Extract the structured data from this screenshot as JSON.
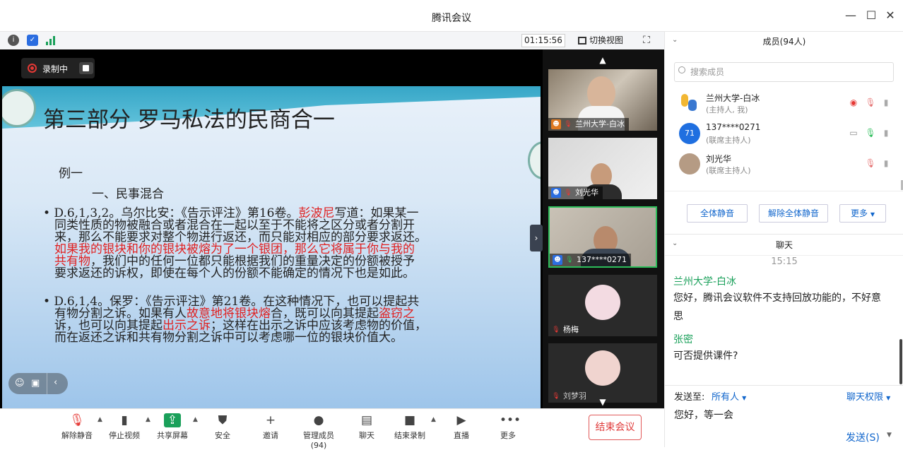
{
  "window": {
    "title": "腾讯会议",
    "controls": {
      "minimize": "—",
      "maximize": "☐",
      "close": "✕"
    }
  },
  "topbar": {
    "timer": "01:15:56",
    "switch_view": "切换视图"
  },
  "recording": {
    "label": "录制中"
  },
  "slide": {
    "title": "第三部分 罗马私法的民商合一",
    "example": "例一",
    "heading": "一、民事混合",
    "p1_lines": [
      [
        {
          "t": "•   D.6,1,3,2。乌尔比安：《告示评注》第16卷。",
          "c": "n"
        },
        {
          "t": "彭波尼",
          "c": "r"
        },
        {
          "t": "写道：如果某一",
          "c": "n"
        }
      ],
      [
        {
          "t": "同类性质的物被融合或者混合在一起以至于不能将之区分或者分割开",
          "c": "n"
        }
      ],
      [
        {
          "t": "来，那么不能要求对整个物进行返还，而只能对相应的部分要求返还。",
          "c": "n"
        }
      ],
      [
        {
          "t": "如果我的银块和你的银块被熔为了一个银团，那么它将属于你与我的",
          "c": "r"
        }
      ],
      [
        {
          "t": "共有物",
          "c": "r"
        },
        {
          "t": "，我们中的任何一位都只能根据我们的重量决定的份额被授予",
          "c": "n"
        }
      ],
      [
        {
          "t": "要求返还的诉权，即使在每个人的份额不能确定的情况下也是如此。",
          "c": "n"
        }
      ]
    ],
    "p2_lines": [
      [
        {
          "t": "• D.6,1,4。保罗：《告示评注》第21卷。在这种情况下，也可以提起共",
          "c": "n"
        }
      ],
      [
        {
          "t": "有物分割之诉。如果有人",
          "c": "n"
        },
        {
          "t": "故意地将银块熔",
          "c": "r"
        },
        {
          "t": "合，既可以向其提起",
          "c": "n"
        },
        {
          "t": "盗窃之",
          "c": "r"
        }
      ],
      [
        {
          "t": "诉，也可以向其提起",
          "c": "n"
        },
        {
          "t": "出示之诉",
          "c": "r"
        },
        {
          "t": "；这样在出示之诉中应该考虑物的价值，",
          "c": "n"
        }
      ],
      [
        {
          "t": "而在返还之诉和共有物分割之诉中可以考虑哪一位的银块价值大。",
          "c": "n"
        }
      ]
    ]
  },
  "video_tiles": [
    {
      "name": "兰州大学-白冰"
    },
    {
      "name": "刘光华"
    },
    {
      "name": "137****0271"
    },
    {
      "name": "杨梅"
    },
    {
      "name": "刘梦羽"
    }
  ],
  "toolbar": [
    {
      "key": "mute",
      "label": "解除静音",
      "icon": "🎙"
    },
    {
      "key": "video",
      "label": "停止视频",
      "icon": "▮"
    },
    {
      "key": "share",
      "label": "共享屏幕",
      "icon": "⇪"
    },
    {
      "key": "security",
      "label": "安全",
      "icon": "⛊"
    },
    {
      "key": "invite",
      "label": "邀请",
      "icon": "+"
    },
    {
      "key": "members",
      "label": "管理成员(94)",
      "icon": "●"
    },
    {
      "key": "chat",
      "label": "聊天",
      "icon": "▤"
    },
    {
      "key": "endrec",
      "label": "结束录制",
      "icon": "■"
    },
    {
      "key": "live",
      "label": "直播",
      "icon": "▶"
    },
    {
      "key": "more",
      "label": "更多",
      "icon": "•••"
    }
  ],
  "end_meeting": "结束会议",
  "members_panel": {
    "title": "成员(94人)",
    "search_placeholder": "搜索成员",
    "members": [
      {
        "name": "兰州大学-白冰",
        "role": "(主持人, 我)"
      },
      {
        "name": "137****0271",
        "role": "(联席主持人)",
        "avatar_text": "71"
      },
      {
        "name": "刘光华",
        "role": "(联席主持人)"
      }
    ],
    "buttons": {
      "mute_all": "全体静音",
      "unmute_all": "解除全体静音",
      "more": "更多"
    }
  },
  "chat_panel": {
    "title": "聊天",
    "time": "15:15",
    "messages": [
      {
        "sender": "兰州大学-白冰",
        "lines": [
          "您好，腾讯会议软件不支持回放功能的，不好意",
          "思"
        ]
      },
      {
        "sender": "张密",
        "lines": [
          "可否提供课件?"
        ]
      }
    ],
    "send_to_label": "发送至:",
    "send_to_value": "所有人",
    "permissions": "聊天权限",
    "input_text": "您好，等一会",
    "send_button": "发送(S)"
  },
  "colors": {
    "accent_blue": "#1166cc",
    "red": "#e02020",
    "green": "#1aa05a"
  }
}
